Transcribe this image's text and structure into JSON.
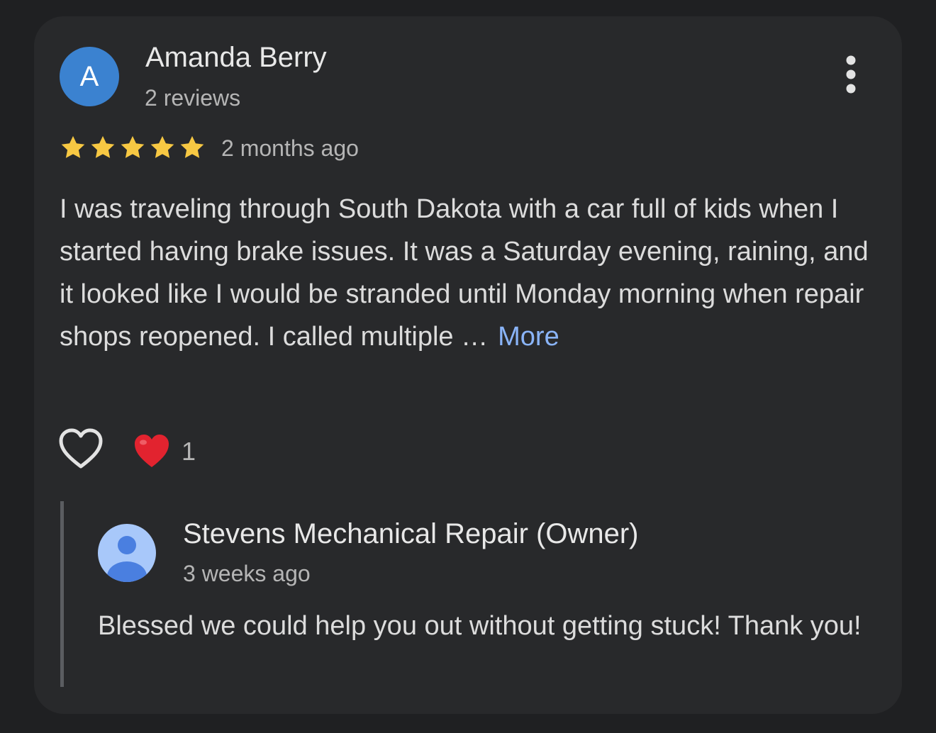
{
  "review": {
    "avatar_letter": "A",
    "reviewer_name": "Amanda Berry",
    "review_count": "2 reviews",
    "rating": 5,
    "time_ago": "2 months ago",
    "text": "I was traveling through South Dakota with a car full of kids when I started having brake issues. It was a Saturday evening, raining, and it looked like I would be stranded until Monday morning when repair shops reopened. I called multiple …",
    "more_label": "More",
    "reaction_count": "1"
  },
  "reply": {
    "owner_name": "Stevens Mechanical Repair (Owner)",
    "time_ago": "3 weeks ago",
    "text": "Blessed we could help you out without getting stuck! Thank you!"
  },
  "icons": {
    "more_options": "more-vert-icon",
    "star": "star-icon",
    "like": "heart-outline-icon",
    "reaction": "red-heart-emoji",
    "owner_avatar": "person-icon"
  },
  "colors": {
    "background": "#1f2022",
    "card": "#28292b",
    "avatar": "#3b82d0",
    "star": "#f7c843",
    "link": "#8ab4f8",
    "reaction": "#e2232f"
  }
}
